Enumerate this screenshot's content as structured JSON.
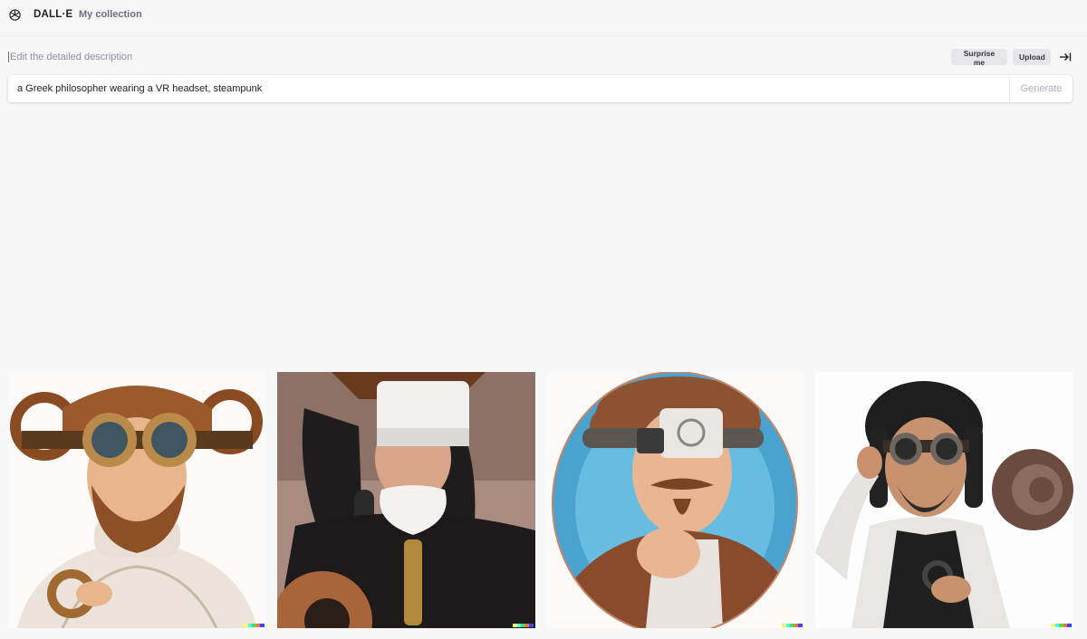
{
  "header": {
    "brand": "DALL·E",
    "nav_collection": "My collection",
    "logo_icon": "openai-logo-icon"
  },
  "prompt": {
    "hint": "Edit the detailed description",
    "value": "a Greek philosopher wearing a VR headset, steampunk",
    "surprise_label": "Surprise me",
    "upload_label": "Upload",
    "generate_label": "Generate",
    "collapse_icon": "collapse-right-icon"
  },
  "results": {
    "images": [
      {
        "subject": "illustrated-philosopher-brass-goggles"
      },
      {
        "subject": "photo-person-white-vr-headset"
      },
      {
        "subject": "oval-portrait-philosopher-headset"
      },
      {
        "subject": "render-man-steampunk-goggles"
      }
    ],
    "signature_colors": [
      "#ffff66",
      "#42ffff",
      "#51da4c",
      "#ff6e3c",
      "#3c46ff"
    ]
  },
  "colors": {
    "background": "#f7f7f8",
    "text": "#202123",
    "muted": "#8e8ea0"
  }
}
